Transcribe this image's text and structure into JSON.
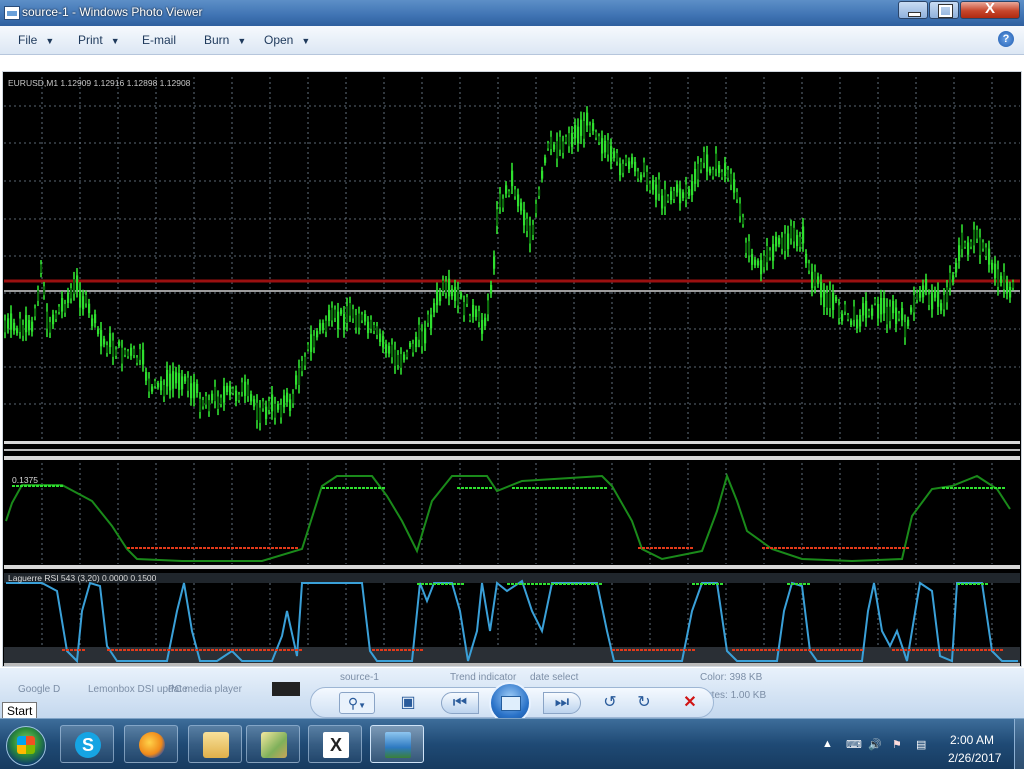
{
  "window": {
    "title": "source-1 - Windows Photo Viewer",
    "close_label": "X"
  },
  "menu": [
    {
      "label": "File",
      "has_arrow": true
    },
    {
      "label": "Print",
      "has_arrow": true
    },
    {
      "label": "E-mail",
      "has_arrow": false
    },
    {
      "label": "Burn",
      "has_arrow": true
    },
    {
      "label": "Open",
      "has_arrow": true
    }
  ],
  "help_label": "?",
  "photo": {
    "symbol_header": "EURUSD,M1  1.12909 1.12916 1.12898 1.12908",
    "indicator1_value": "0.1375",
    "indicator2_header": "Laguerre RSI 543 (3,20) 0.0000 0.1500"
  },
  "thumbnails_faded": [
    "Google D",
    "Lemonbox DSI update",
    "PC media player",
    "source-1",
    "Trend indicator",
    "date select",
    "Color: 398 KB",
    "Bytes: 1.00 KB"
  ],
  "tooltip": "Start",
  "controls": {
    "zoom_icon": "zoom-magnifier-icon",
    "fit_icon": "actual-size-icon",
    "prev_icon": "previous-icon",
    "slideshow_icon": "slideshow-icon",
    "next_icon": "next-icon",
    "rotate_ccw_icon": "rotate-counterclockwise-icon",
    "rotate_cw_icon": "rotate-clockwise-icon",
    "delete_icon": "delete-icon"
  },
  "taskbar": {
    "items": [
      "skype-icon",
      "firefox-icon",
      "explorer-folder-icon",
      "ebook-icon",
      "metatrader-icon",
      "photo-viewer-icon"
    ],
    "skype_glyph": "S",
    "mt_glyph": "X"
  },
  "clock": {
    "time": "2:00 AM",
    "date": "2/26/2017"
  },
  "colors": {
    "candle_up": "#2fe02f",
    "signal_line": "#1a8a1a",
    "level_dots": "#e23a1a",
    "rsi_line": "#3aa0d8",
    "red_level": "#9b1010",
    "grid": "#7a8a9a"
  }
}
